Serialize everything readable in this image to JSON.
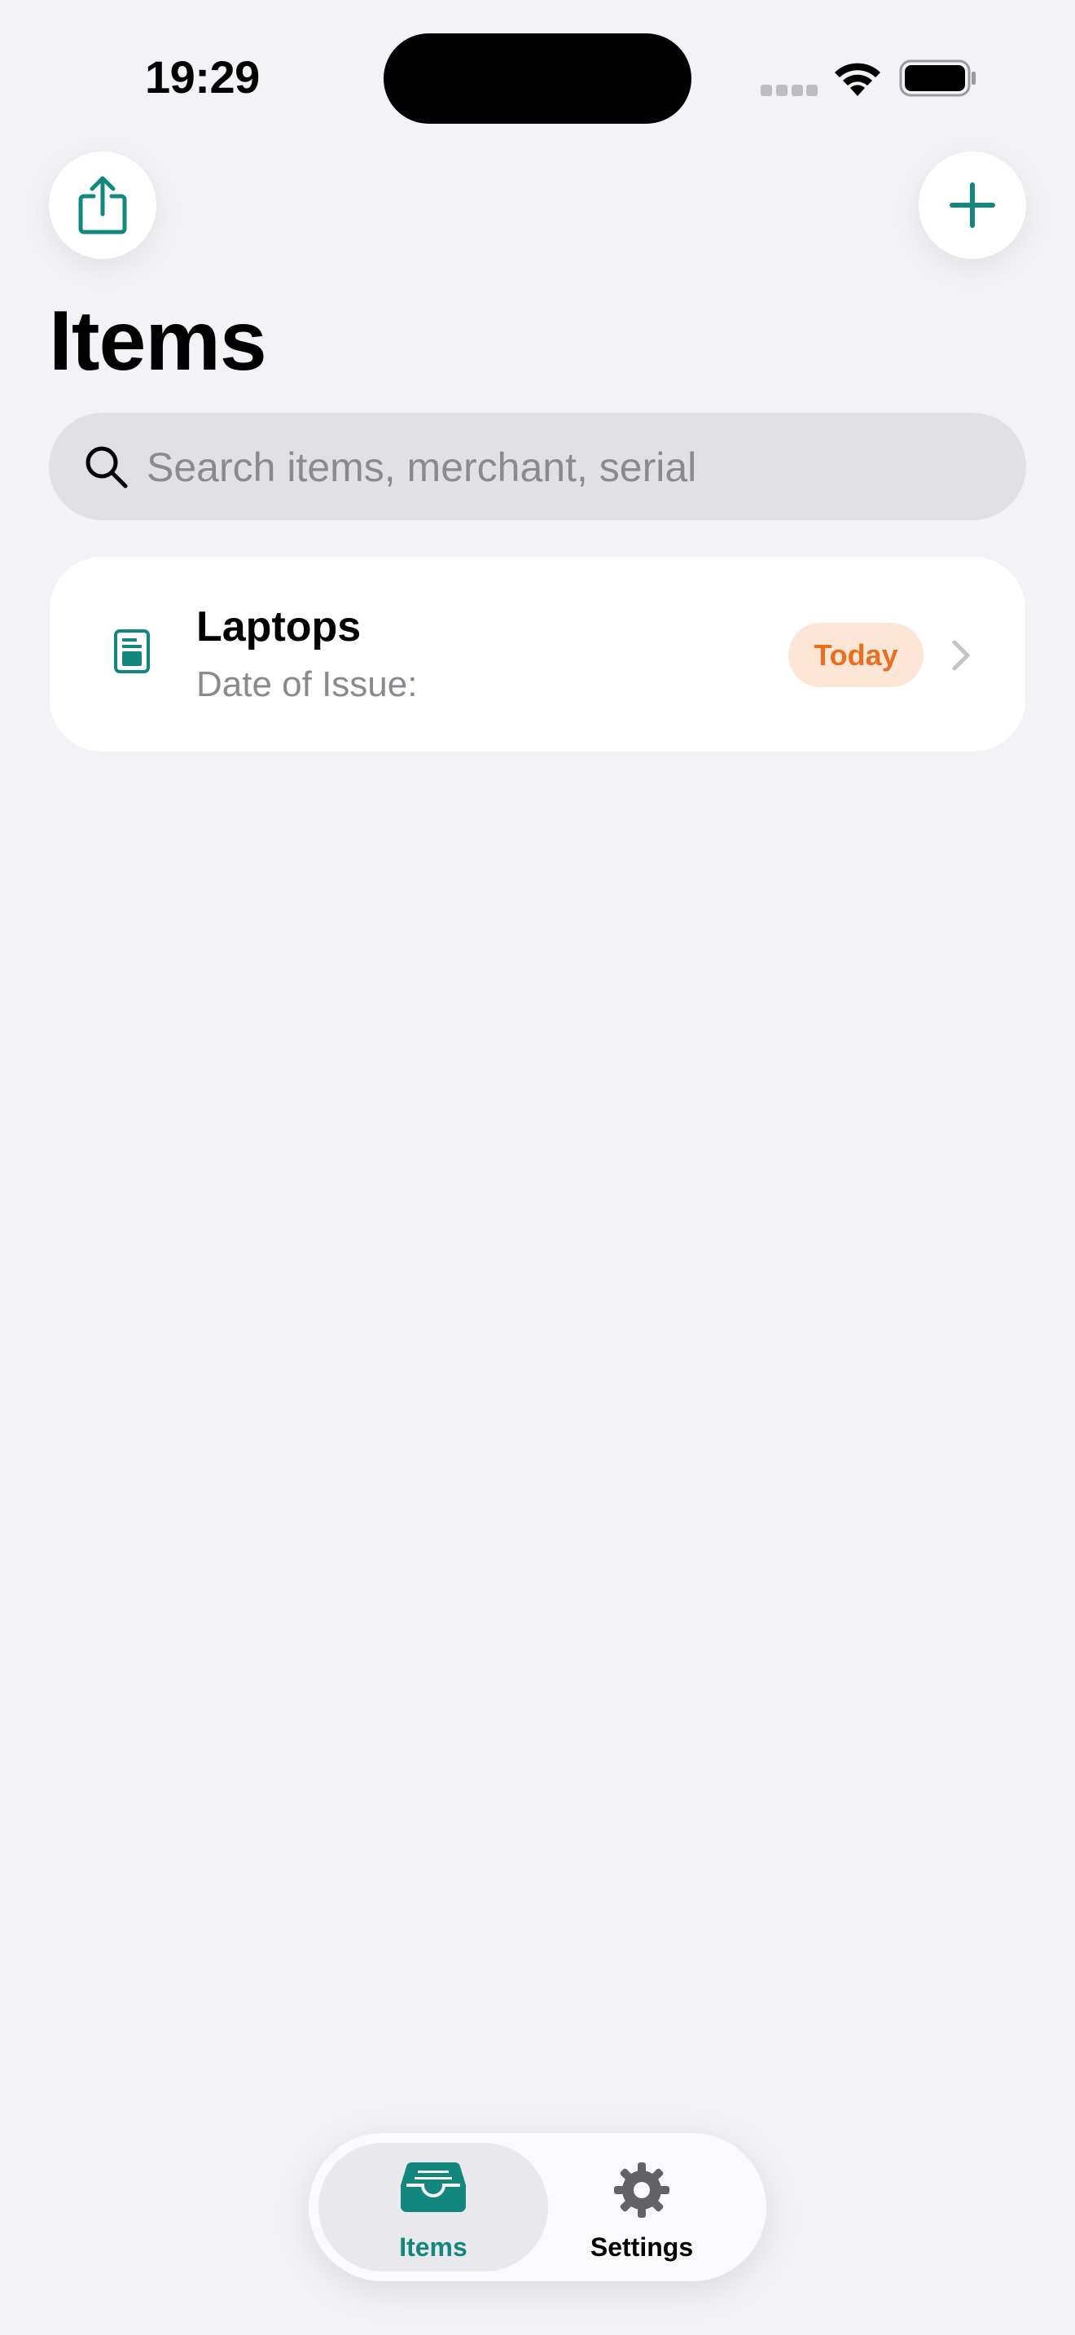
{
  "status_bar": {
    "time": "19:29"
  },
  "colors": {
    "accent": "#13877e",
    "badge_bg": "#fde6d6",
    "badge_text": "#e86f20",
    "background": "#f2f2f7"
  },
  "header": {
    "title": "Items",
    "share_icon": "share-icon",
    "add_icon": "plus-icon"
  },
  "search": {
    "placeholder": "Search items, merchant, serial",
    "value": ""
  },
  "items": [
    {
      "name": "Laptops",
      "subtitle": "Date of Issue:",
      "badge": "Today",
      "icon": "document-icon"
    }
  ],
  "tabbar": {
    "tabs": [
      {
        "label": "Items",
        "icon": "tray-icon",
        "selected": true
      },
      {
        "label": "Settings",
        "icon": "gear-icon",
        "selected": false
      }
    ]
  }
}
